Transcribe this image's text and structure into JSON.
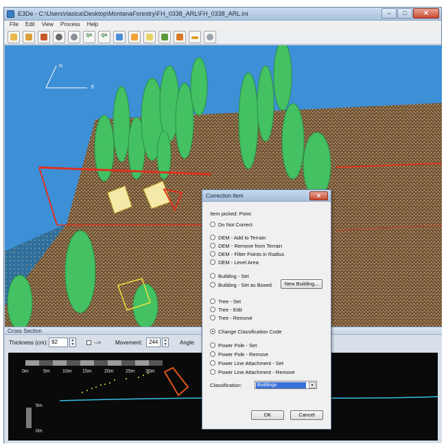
{
  "window": {
    "title": "E3De - C:\\Users\\rlasica\\Desktop\\MontanaForestry\\FH_0338_ARL\\FH_0338_ARL.ini",
    "controls": {
      "minimize": "–",
      "maximize": "□",
      "close": "✕"
    }
  },
  "menu": [
    "File",
    "Edit",
    "View",
    "Process",
    "Help"
  ],
  "toolbar": {
    "icons": [
      "open-folder-icon",
      "save-icon",
      "image-icon",
      "target-icon",
      "gear-icon",
      "qa-icon",
      "qa-arrow-icon",
      "cube-icon",
      "orange-panel-icon",
      "document-icon",
      "hand-icon",
      "tree-icon",
      "bar-icon",
      "round-icon"
    ],
    "qa_label": "QA"
  },
  "viewport": {
    "axis_north": "N",
    "axis_east": "E",
    "colors": {
      "sky": "#3d8fd6",
      "terrain": "#7a5838",
      "trees": "#43c163",
      "selection": "#e0311f"
    }
  },
  "cross_section": {
    "title": "Cross Section",
    "thickness_label": "Thickness (cm):",
    "thickness_value": "92",
    "arrow_label": "-->",
    "movement_label": "Movement:",
    "movement_value": "244",
    "angle_label": "Angle:",
    "ruler": [
      "0m",
      "5m",
      "10m",
      "15m",
      "20m",
      "25m",
      "30m"
    ],
    "height_top": "5m",
    "height_bottom": "0m"
  },
  "dialog": {
    "title": "Correction Item",
    "close": "✕",
    "item_picked": "Item picked: Point",
    "options": [
      {
        "label": "Do Not Correct",
        "checked": false
      },
      {
        "label": "DEM - Add to Terrain",
        "checked": false
      },
      {
        "label": "DEM - Remove from Terrain",
        "checked": false
      },
      {
        "label": "DEM - Filter Points in Radius",
        "checked": false
      },
      {
        "label": "DEM - Level Area",
        "checked": false
      },
      {
        "label": "Building - Set",
        "checked": false
      },
      {
        "label": "Building - Set as Boxed",
        "checked": false
      },
      {
        "label": "Tree - Set",
        "checked": false
      },
      {
        "label": "Tree - Edit",
        "checked": false
      },
      {
        "label": "Tree - Remove",
        "checked": false
      },
      {
        "label": "Change Classification Code",
        "checked": true
      },
      {
        "label": "Power Pole - Set",
        "checked": false
      },
      {
        "label": "Power Pole - Remove",
        "checked": false
      },
      {
        "label": "Power Line Attachment - Set",
        "checked": false
      },
      {
        "label": "Power Line Attachment - Remove",
        "checked": false
      }
    ],
    "new_building": "New Building...",
    "classification_label": "Classification:",
    "classification_value": "Buildings",
    "ok": "OK",
    "cancel": "Cancel"
  }
}
